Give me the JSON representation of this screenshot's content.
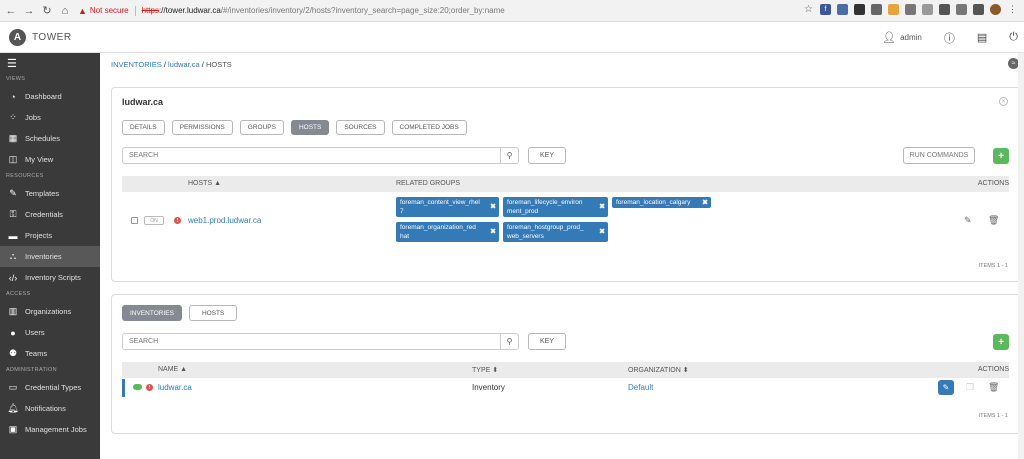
{
  "browser": {
    "not_secure": "Not secure",
    "https": "https",
    "host": "://tower.ludwar.ca",
    "path": "/#/inventories/inventory/2/hosts?inventory_search=page_size:20;order_by:name"
  },
  "app": {
    "brand": "TOWER",
    "logo_letter": "A",
    "user": "admin"
  },
  "sidebar": {
    "sections": {
      "views": "VIEWS",
      "resources": "RESOURCES",
      "access": "ACCESS",
      "administration": "ADMINISTRATION"
    },
    "items": [
      {
        "label": "Dashboard",
        "icon": "dashboard-icon"
      },
      {
        "label": "Jobs",
        "icon": "jobs-icon"
      },
      {
        "label": "Schedules",
        "icon": "calendar-icon"
      },
      {
        "label": "My View",
        "icon": "columns-icon"
      },
      {
        "label": "Templates",
        "icon": "pencil-square-icon"
      },
      {
        "label": "Credentials",
        "icon": "key-icon"
      },
      {
        "label": "Projects",
        "icon": "folder-icon"
      },
      {
        "label": "Inventories",
        "icon": "sitemap-icon"
      },
      {
        "label": "Inventory Scripts",
        "icon": "code-icon"
      },
      {
        "label": "Organizations",
        "icon": "building-icon"
      },
      {
        "label": "Users",
        "icon": "user-icon"
      },
      {
        "label": "Teams",
        "icon": "users-icon"
      },
      {
        "label": "Credential Types",
        "icon": "id-card-icon"
      },
      {
        "label": "Notifications",
        "icon": "bell-icon"
      },
      {
        "label": "Management Jobs",
        "icon": "briefcase-icon"
      }
    ]
  },
  "breadcrumb": {
    "inventories": "INVENTORIES",
    "inventory": "ludwar.ca",
    "current": "HOSTS",
    "sep": "/"
  },
  "panel1": {
    "title": "ludwar.ca",
    "tabs": [
      "DETAILS",
      "PERMISSIONS",
      "GROUPS",
      "HOSTS",
      "SOURCES",
      "COMPLETED JOBS"
    ],
    "active_tab": "HOSTS",
    "search_placeholder": "SEARCH",
    "key": "KEY",
    "run_commands": "RUN COMMANDS",
    "add": "+",
    "columns": {
      "hosts": "HOSTS",
      "related_groups": "RELATED GROUPS",
      "actions": "ACTIONS"
    },
    "host": {
      "name": "web1.prod.ludwar.ca",
      "toggle": "ON",
      "groups": [
        [
          "foreman_content_view_rhel",
          "7"
        ],
        [
          "foreman_lifecycle_environ",
          "ment_prod"
        ],
        [
          "foreman_location_calgary"
        ],
        [
          "foreman_organization_red",
          "hat"
        ],
        [
          "foreman_hostgroup_prod_",
          "web_servers"
        ]
      ]
    },
    "items": "ITEMS 1 - 1"
  },
  "panel2": {
    "tabs": [
      "INVENTORIES",
      "HOSTS"
    ],
    "active_tab": "INVENTORIES",
    "search_placeholder": "SEARCH",
    "key": "KEY",
    "add": "+",
    "columns": {
      "name": "NAME",
      "type": "TYPE",
      "organization": "ORGANIZATION",
      "actions": "ACTIONS"
    },
    "row": {
      "name": "ludwar.ca",
      "type": "Inventory",
      "organization": "Default"
    },
    "items": "ITEMS 1 - 1"
  },
  "colors": {
    "sidebar_bg": "#3a3a3a",
    "link": "#337ab7",
    "add_green": "#5cb85c",
    "error_red": "#d9534f"
  }
}
